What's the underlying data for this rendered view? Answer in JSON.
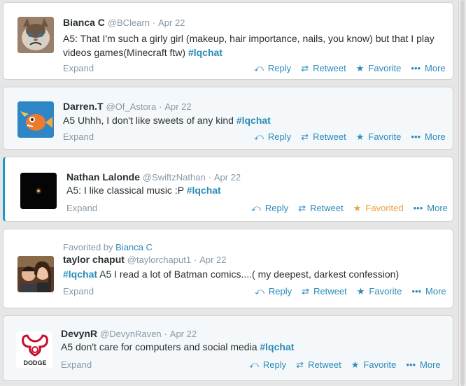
{
  "tweets": [
    {
      "name": "Bianca C",
      "handle": "@BClearn",
      "sep": "·",
      "date": "Apr 22",
      "text_before": "A5: That I'm such a girly girl (makeup, hair importance, nails, you know) but that I play videos games(Minecraft ftw)",
      "hashtag": "#lqchat",
      "text_after": "",
      "expand": "Expand",
      "reply": "Reply",
      "retweet": "Retweet",
      "favorite": "Favorite",
      "more": "More",
      "avatar_icon": "grumpy-cat-avatar"
    },
    {
      "name": "Darren.T",
      "handle": "@Of_Astora",
      "sep": "·",
      "date": "Apr 22",
      "text_before": "A5 Uhhh, I don't like sweets of any kind",
      "hashtag": "#lqchat",
      "text_after": "",
      "expand": "Expand",
      "reply": "Reply",
      "retweet": "Retweet",
      "favorite": "Favorite",
      "more": "More",
      "avatar_icon": "fish-avatar"
    },
    {
      "name": "Nathan Lalonde",
      "handle": "@SwiftzNathan",
      "sep": "·",
      "date": "Apr 22",
      "text_before": "A5:  I like classical music :P",
      "hashtag": "#lqchat",
      "text_after": "",
      "expand": "Expand",
      "reply": "Reply",
      "retweet": "Retweet",
      "favorite": "Favorited",
      "more": "More",
      "avatar_icon": "dark-star-avatar"
    },
    {
      "context_prefix": "Favorited by",
      "context_who": "Bianca C",
      "name": "taylor chaput",
      "handle": "@taylorchaput1",
      "sep": "·",
      "date": "Apr 22",
      "text_before": "",
      "hashtag": "#lqchat",
      "text_after": "A5 I read a lot of Batman comics....( my deepest, darkest confession)",
      "expand": "Expand",
      "reply": "Reply",
      "retweet": "Retweet",
      "favorite": "Favorite",
      "more": "More",
      "avatar_icon": "couple-photo-avatar"
    },
    {
      "name": "DevynR",
      "handle": "@DevynRaven",
      "sep": "·",
      "date": "Apr 22",
      "text_before": "A5 don't care for computers and social media ",
      "hashtag": "#lqchat",
      "text_after": "",
      "expand": "Expand",
      "reply": "Reply",
      "retweet": "Retweet",
      "favorite": "Favorite",
      "more": "More",
      "avatar_icon": "dodge-logo-avatar",
      "avatar_logo_text": "DODGE"
    }
  ],
  "colors": {
    "link": "#2a8ab8",
    "meta": "#8899a6",
    "favorited": "#e9a03b",
    "focus_border": "#1d97c7"
  },
  "icons": {
    "reply": "reply-arrow-icon",
    "retweet": "retweet-icon",
    "favorite": "star-icon",
    "more": "ellipsis-icon"
  }
}
